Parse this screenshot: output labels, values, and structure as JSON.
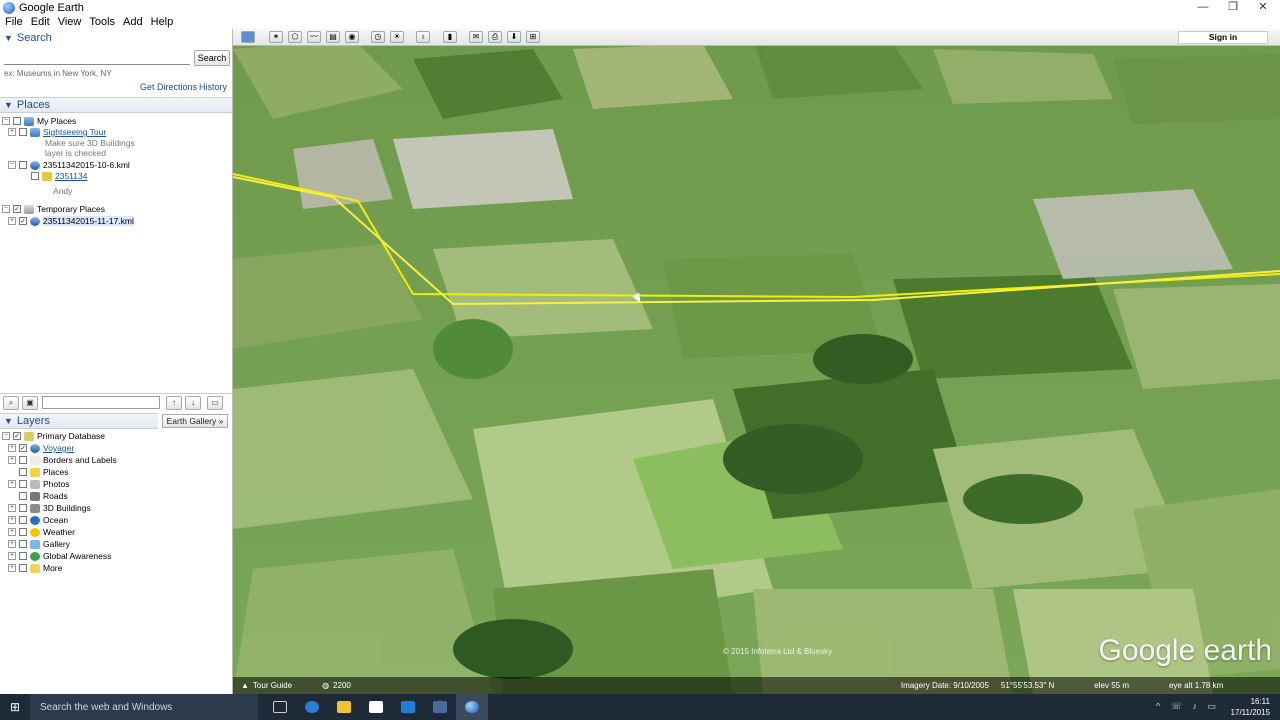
{
  "window": {
    "title": "Google Earth",
    "controls": [
      "—",
      "❐",
      "✕"
    ]
  },
  "menu": [
    "File",
    "Edit",
    "View",
    "Tools",
    "Add",
    "Help"
  ],
  "search": {
    "header": "Search",
    "button": "Search",
    "hint": "ex: Museums in New York, NY",
    "get_directions": "Get Directions",
    "history": "History"
  },
  "places": {
    "header": "Places",
    "items": [
      {
        "label": "My Places",
        "checked": false,
        "icon": "folder-icon"
      },
      {
        "label": "Sightseeing Tour",
        "checked": false,
        "icon": "tour-icon",
        "style": "link"
      },
      {
        "label": "Make sure 3D Buildings",
        "style": "grey"
      },
      {
        "label": "layer is checked",
        "style": "grey"
      },
      {
        "label": "23511342015-10-6.kml",
        "checked": false,
        "icon": "kml-icon"
      },
      {
        "label": "2351134",
        "checked": false,
        "icon": "path-icon",
        "style": "link"
      },
      {
        "label": "Andy",
        "style": "grey"
      },
      {
        "label": "Temporary Places",
        "checked": true,
        "icon": "folder-icon"
      },
      {
        "label": "23511342015-11-17.kml",
        "checked": true,
        "icon": "kml-icon",
        "selected": true
      }
    ]
  },
  "gallery_button": "Earth Gallery  »",
  "layers": {
    "header": "Layers",
    "items": [
      {
        "label": "Primary Database",
        "checked": true
      },
      {
        "label": "Voyager",
        "checked": true,
        "style": "link"
      },
      {
        "label": "Borders and Labels",
        "checked": false
      },
      {
        "label": "Places",
        "checked": false
      },
      {
        "label": "Photos",
        "checked": false
      },
      {
        "label": "Roads",
        "checked": false
      },
      {
        "label": "3D Buildings",
        "checked": false
      },
      {
        "label": "Ocean",
        "checked": false
      },
      {
        "label": "Weather",
        "checked": false
      },
      {
        "label": "Gallery",
        "checked": false
      },
      {
        "label": "Global Awareness",
        "checked": false
      },
      {
        "label": "More",
        "checked": false
      }
    ]
  },
  "map": {
    "sign_in": "Sign in",
    "watermark": "Google earth",
    "copyright": "© 2015 Infoterra Ltd & Bluesky",
    "tour_guide": "Tour Guide",
    "imagery_date": "Imagery Date: 9/10/2005",
    "coords": "51°55'53.53\" N",
    "elevation": "elev  55 m",
    "eye_alt": "eye alt  1.78 km",
    "streaming": "2200"
  },
  "taskbar": {
    "search_placeholder": "Search the web and Windows",
    "time": "16:11",
    "date": "17/11/2015"
  },
  "colors": {
    "accent": "#1a4f9c",
    "track": "#f2f000",
    "taskbar": "#1e2a38"
  }
}
